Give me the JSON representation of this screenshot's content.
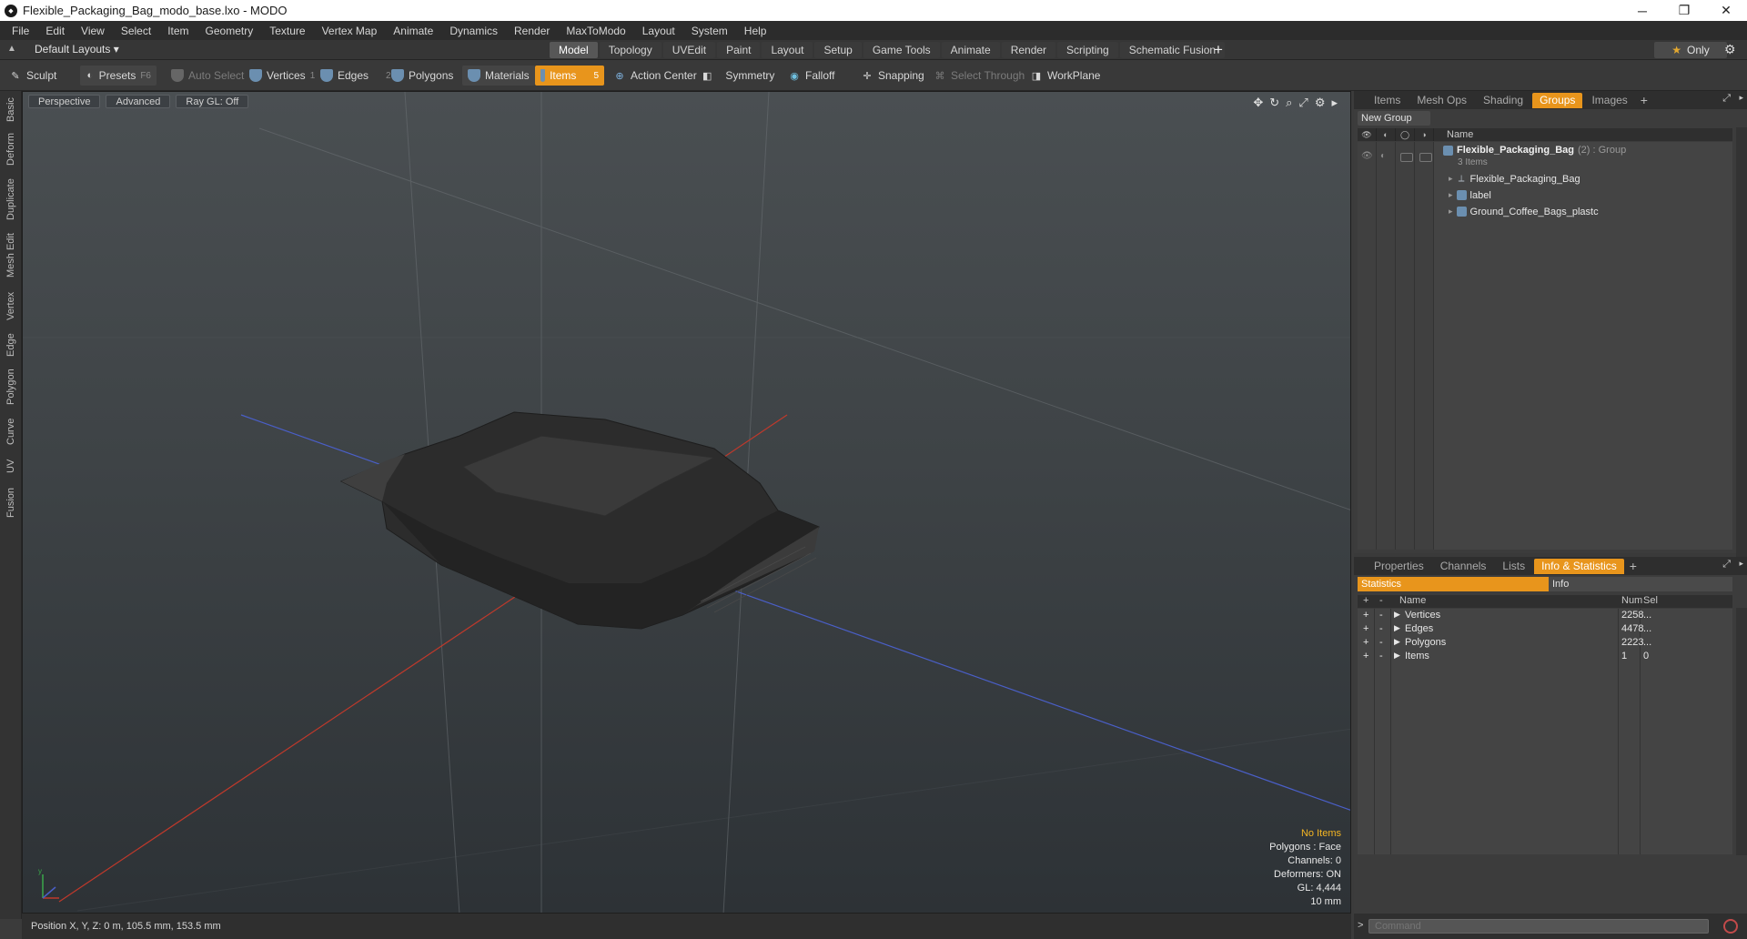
{
  "window": {
    "title": "Flexible_Packaging_Bag_modo_base.lxo - MODO",
    "minimize_glyph": "─",
    "maximize_glyph": "❐",
    "close_glyph": "✕"
  },
  "menu": [
    "File",
    "Edit",
    "View",
    "Select",
    "Item",
    "Geometry",
    "Texture",
    "Vertex Map",
    "Animate",
    "Dynamics",
    "Render",
    "MaxToModo",
    "Layout",
    "System",
    "Help"
  ],
  "layout_bar": {
    "layouts_label": "Default Layouts ▾",
    "tabs": [
      "Model",
      "Topology",
      "UVEdit",
      "Paint",
      "Layout",
      "Setup",
      "Game Tools",
      "Animate",
      "Render",
      "Scripting",
      "Schematic Fusion"
    ],
    "active_tab": "Model",
    "add_glyph": "+",
    "only_label": "Only",
    "star_glyph": "★"
  },
  "toolbar": {
    "sculpt": "Sculpt",
    "presets": "Presets",
    "presets_hotkey": "F6",
    "auto_select": "Auto Select",
    "vertices": "Vertices",
    "vertices_hotkey": "1",
    "edges": "Edges",
    "edges_hotkey": "2",
    "polygons": "Polygons",
    "materials": "Materials",
    "items": "Items",
    "items_hotkey": "5",
    "action_center": "Action Center",
    "symmetry": "Symmetry",
    "falloff": "Falloff",
    "snapping": "Snapping",
    "select_through": "Select Through",
    "workplane": "WorkPlane"
  },
  "left_tabs": [
    "Basic",
    "Deform",
    "Duplicate",
    "Mesh Edit",
    "Vertex",
    "Edge",
    "Polygon",
    "Curve",
    "UV",
    "Fusion"
  ],
  "viewport": {
    "view_mode": "Perspective",
    "shading": "Advanced",
    "raygl": "Ray GL: Off",
    "stats": {
      "no_items": "No Items",
      "polygons": "Polygons : Face",
      "channels": "Channels: 0",
      "deformers": "Deformers: ON",
      "gl": "GL: 4,444",
      "scale": "10 mm"
    },
    "axis_y": "y"
  },
  "status": {
    "position": "Position X, Y, Z:  0 m, 105.5 mm, 153.5 mm"
  },
  "groups_panel": {
    "tabs": [
      "Items",
      "Mesh Ops",
      "Shading",
      "Groups",
      "Images"
    ],
    "active_tab": "Groups",
    "new_group": "New Group",
    "name_header": "Name",
    "group": {
      "name": "Flexible_Packaging_Bag",
      "meta": "(2) : Group",
      "count": "3 Items"
    },
    "children": [
      "Flexible_Packaging_Bag",
      "label",
      "Ground_Coffee_Bags_plastc"
    ]
  },
  "stats_panel": {
    "tabs": [
      "Properties",
      "Channels",
      "Lists",
      "Info & Statistics"
    ],
    "active_tab": "Info & Statistics",
    "subtabs": [
      "Statistics",
      "Info"
    ],
    "headers": {
      "name": "Name",
      "num": "Num",
      "sel": "Sel"
    },
    "rows": [
      {
        "name": "Vertices",
        "num": "2258",
        "sel": "..."
      },
      {
        "name": "Edges",
        "num": "4478",
        "sel": "..."
      },
      {
        "name": "Polygons",
        "num": "2223",
        "sel": "..."
      },
      {
        "name": "Items",
        "num": "1",
        "sel": "0"
      }
    ]
  },
  "command": {
    "placeholder": "Command",
    "prompt": ">"
  },
  "colors": {
    "accent": "#e8951c",
    "x_axis": "#c0392b",
    "z_axis": "#4a5fc8",
    "bag": "#2a2a2a"
  }
}
